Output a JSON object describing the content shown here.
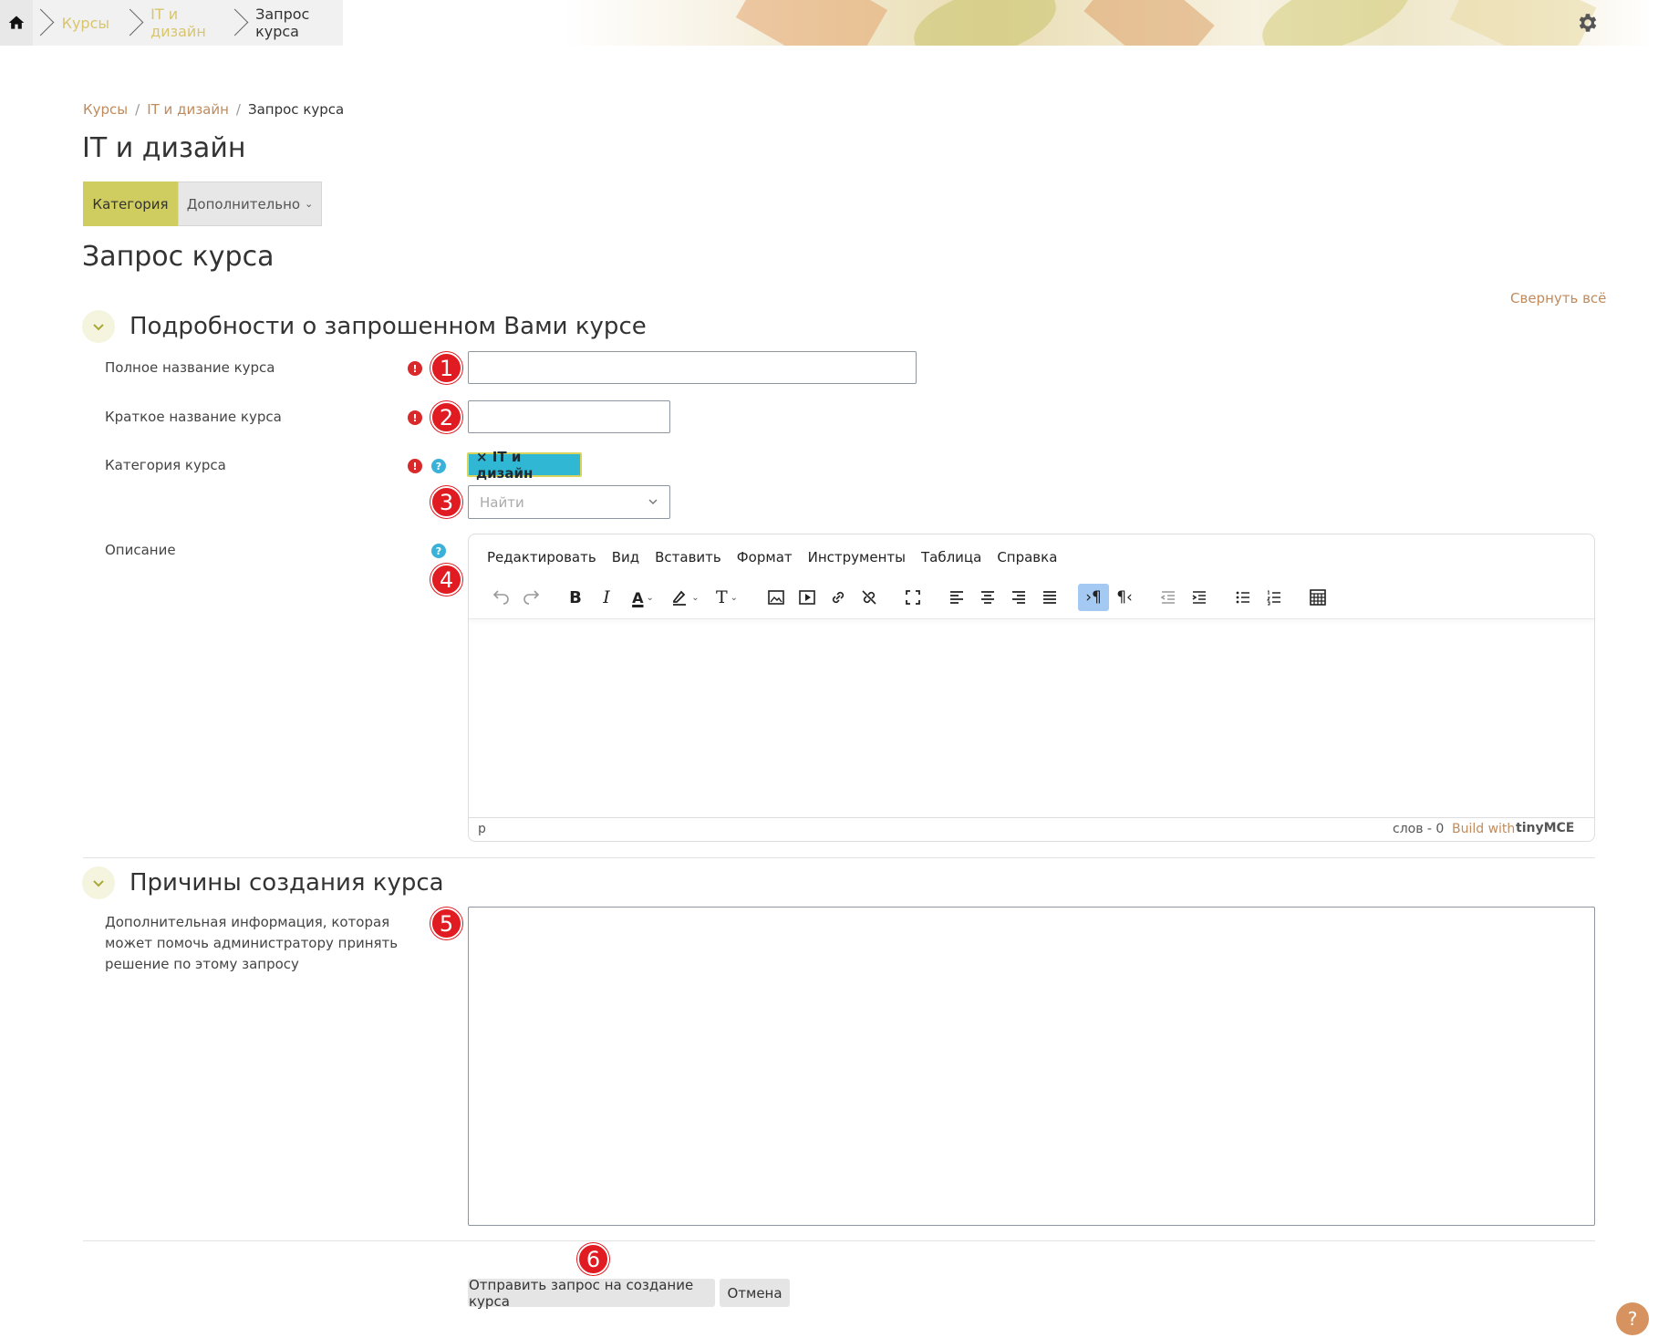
{
  "topbar": {
    "crumbs": [
      "Курсы",
      "IT и дизайн",
      "Запрос курса"
    ],
    "home_icon": "home-icon",
    "settings_icon": "gear-icon"
  },
  "breadcrumb": {
    "items": [
      "Курсы",
      "IT и дизайн"
    ],
    "current": "Запрос курса",
    "separator": "/"
  },
  "category_heading": "IT и дизайн",
  "tabs": {
    "active": "Категория",
    "more": "Дополнительно"
  },
  "page_heading": "Запрос курса",
  "collapse_all": "Свернуть всё",
  "section1": {
    "title": "Подробности о запрошенном Вами курсе",
    "fullname_label": "Полное название курса",
    "fullname_value": "",
    "shortname_label": "Краткое название курса",
    "shortname_value": "",
    "category_label": "Категория курса",
    "category_tag": "× IT и дизайн",
    "category_search_placeholder": "Найти",
    "description_label": "Описание"
  },
  "editor": {
    "menu": [
      "Редактировать",
      "Вид",
      "Вставить",
      "Формат",
      "Инструменты",
      "Таблица",
      "Справка"
    ],
    "path": "p",
    "word_count": "слов - 0",
    "build_with": "Build with",
    "brand": "tinyMCE"
  },
  "section2": {
    "title": "Причины создания курса",
    "reason_label": "Дополнительная информация, которая может помочь администратору принять решение по этому запросу"
  },
  "buttons": {
    "submit": "Отправить запрос на создание курса",
    "cancel": "Отмена"
  },
  "markers": [
    "1",
    "2",
    "3",
    "4",
    "5",
    "6"
  ],
  "colors": {
    "accent": "#cfcd5f",
    "link": "#c08b5c",
    "required": "#d9292b",
    "help": "#39b1d8",
    "marker": "#e01b22"
  },
  "help_fab": "?"
}
